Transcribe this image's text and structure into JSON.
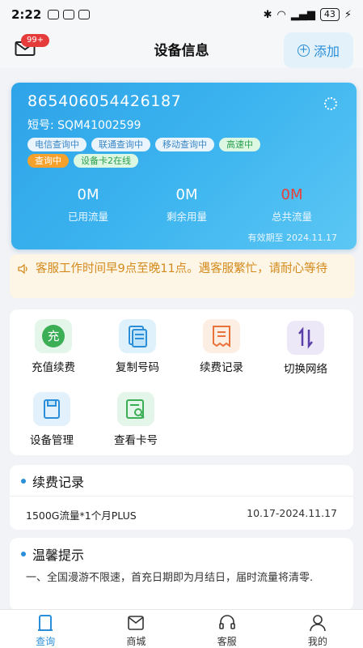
{
  "status_bar": {
    "time": "2:22",
    "battery": "43"
  },
  "header": {
    "title": "设备信息",
    "badge": "99+",
    "add_label": "添加"
  },
  "device": {
    "number": "865406054426187",
    "short_label": "短号",
    "short_value": "SQM41002599",
    "tags_row1": [
      "电信查询中",
      "联通查询中",
      "移动查询中",
      "高速中"
    ],
    "tags_row2": [
      "查询中",
      "设备卡2在线"
    ],
    "stats": [
      {
        "value": "0M",
        "label": "已用流量"
      },
      {
        "value": "0M",
        "label": "剩余用量"
      },
      {
        "value": "0M",
        "label": "总共流量"
      }
    ],
    "valid_until": "有效期至 2024.11.17"
  },
  "notice": "客服工作时间早9点至晚11点。遇客服繁忙，请耐心等待",
  "functions": [
    {
      "label": "充值续费",
      "icon": "recharge-icon"
    },
    {
      "label": "复制号码",
      "icon": "copy-icon"
    },
    {
      "label": "续费记录",
      "icon": "receipt-icon"
    },
    {
      "label": "切换网络",
      "icon": "switch-network-icon"
    },
    {
      "label": "设备管理",
      "icon": "device-icon"
    },
    {
      "label": "查看卡号",
      "icon": "view-card-icon"
    }
  ],
  "renewal": {
    "title": "续费记录",
    "plan": "1500G流量*1个月PLUS",
    "period": "10.17-2024.11.17"
  },
  "tips": {
    "title": "温馨提示",
    "text": "一、全国漫游不限速，首充日期即为月结日，届时流量将清零."
  },
  "tabs": [
    "查询",
    "商城",
    "客服",
    "我的"
  ],
  "colors": {
    "accent": "#2a8fd8",
    "card": "#3cb4ef",
    "warning": "#d38a1b",
    "danger": "#e8403a"
  }
}
